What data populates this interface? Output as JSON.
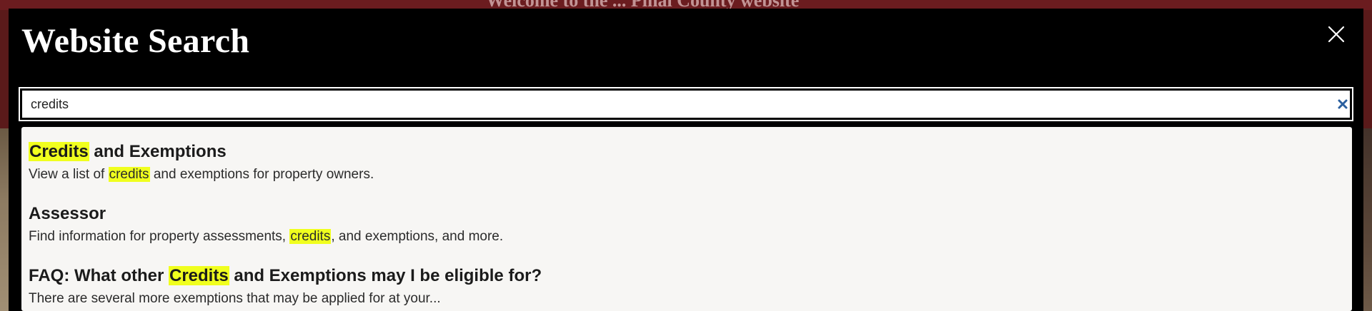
{
  "background": {
    "banner_text": "Welcome to the ... Pinal County website"
  },
  "modal": {
    "title": "Website Search",
    "close_icon": "close-icon"
  },
  "search": {
    "value": "credits",
    "placeholder": "",
    "clear_icon": "clear-icon"
  },
  "colors": {
    "highlight": "#f0ff1e",
    "clear_icon": "#2a5f9e",
    "modal_background": "#000000",
    "results_background": "#f7f6f4"
  },
  "results": [
    {
      "title_parts": [
        {
          "text": "Credits",
          "highlight": true
        },
        {
          "text": " and Exemptions",
          "highlight": false
        }
      ],
      "desc_parts": [
        {
          "text": "View a list of ",
          "highlight": false
        },
        {
          "text": "credits",
          "highlight": true
        },
        {
          "text": " and exemptions for property owners.",
          "highlight": false
        }
      ]
    },
    {
      "title_parts": [
        {
          "text": "Assessor",
          "highlight": false
        }
      ],
      "desc_parts": [
        {
          "text": "Find information for property assessments, ",
          "highlight": false
        },
        {
          "text": "credits",
          "highlight": true
        },
        {
          "text": ", and exemptions, and more.",
          "highlight": false
        }
      ]
    },
    {
      "title_parts": [
        {
          "text": "FAQ: What other ",
          "highlight": false
        },
        {
          "text": "Credits",
          "highlight": true
        },
        {
          "text": " and Exemptions may I be eligible for?",
          "highlight": false
        }
      ],
      "desc_parts": [
        {
          "text": "There are several more exemptions that may be applied for at your...",
          "highlight": false
        }
      ]
    }
  ]
}
